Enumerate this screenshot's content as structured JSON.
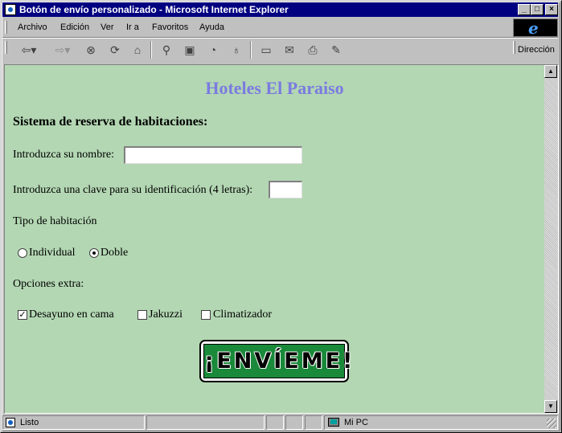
{
  "window": {
    "title": "Botón de envío personalizado - Microsoft Internet Explorer",
    "controls": {
      "minimize": "_",
      "maximize": "□",
      "close": "×"
    }
  },
  "menubar": {
    "items": [
      {
        "label": "Archivo"
      },
      {
        "label": "Edición"
      },
      {
        "label": "Ver"
      },
      {
        "label": "Ir a"
      },
      {
        "label": "Favoritos"
      },
      {
        "label": "Ayuda"
      }
    ],
    "logo": "e"
  },
  "toolbar": {
    "buttons": [
      {
        "icon": "back-arrow-icon",
        "glyph": "⇦▾"
      },
      {
        "icon": "forward-arrow-icon",
        "glyph": "⇨▾"
      },
      {
        "icon": "stop-icon",
        "glyph": "⊗"
      },
      {
        "icon": "refresh-icon",
        "glyph": "⟳"
      },
      {
        "icon": "home-icon",
        "glyph": "⌂"
      },
      {
        "icon": "search-icon",
        "glyph": "⚲"
      },
      {
        "icon": "favorites-icon",
        "glyph": "▣"
      },
      {
        "icon": "history-icon",
        "glyph": "◔"
      },
      {
        "icon": "channels-icon",
        "glyph": "♁"
      },
      {
        "icon": "fullscreen-icon",
        "glyph": "▭"
      },
      {
        "icon": "mail-icon",
        "glyph": "✉"
      },
      {
        "icon": "print-icon",
        "glyph": "⎙"
      },
      {
        "icon": "edit-icon",
        "glyph": "✎"
      }
    ],
    "address_label": "Dirección"
  },
  "page": {
    "heading": "Hoteles El Paraiso",
    "subheading": "Sistema de reserva de habitaciones:",
    "name_label": "Introduzca su nombre:",
    "name_value": "",
    "key_label": "Introduzca una clave para su identificación (4 letras):",
    "key_value": "",
    "room_type_label": "Tipo de habitación",
    "room_options": [
      {
        "label": "Individual",
        "checked": false
      },
      {
        "label": "Doble",
        "checked": true
      }
    ],
    "extras_label": "Opciones extra:",
    "extra_options": [
      {
        "label": "Desayuno en cama",
        "checked": true
      },
      {
        "label": "Jakuzzi",
        "checked": false
      },
      {
        "label": "Climatizador",
        "checked": false
      }
    ],
    "submit_label": "¡ENVÍEME!",
    "submit_color": "#1a8a3a",
    "heading_color": "#7b7be0",
    "background_color": "#b3d7b3"
  },
  "statusbar": {
    "status": "Listo",
    "zone": "Mi PC"
  }
}
